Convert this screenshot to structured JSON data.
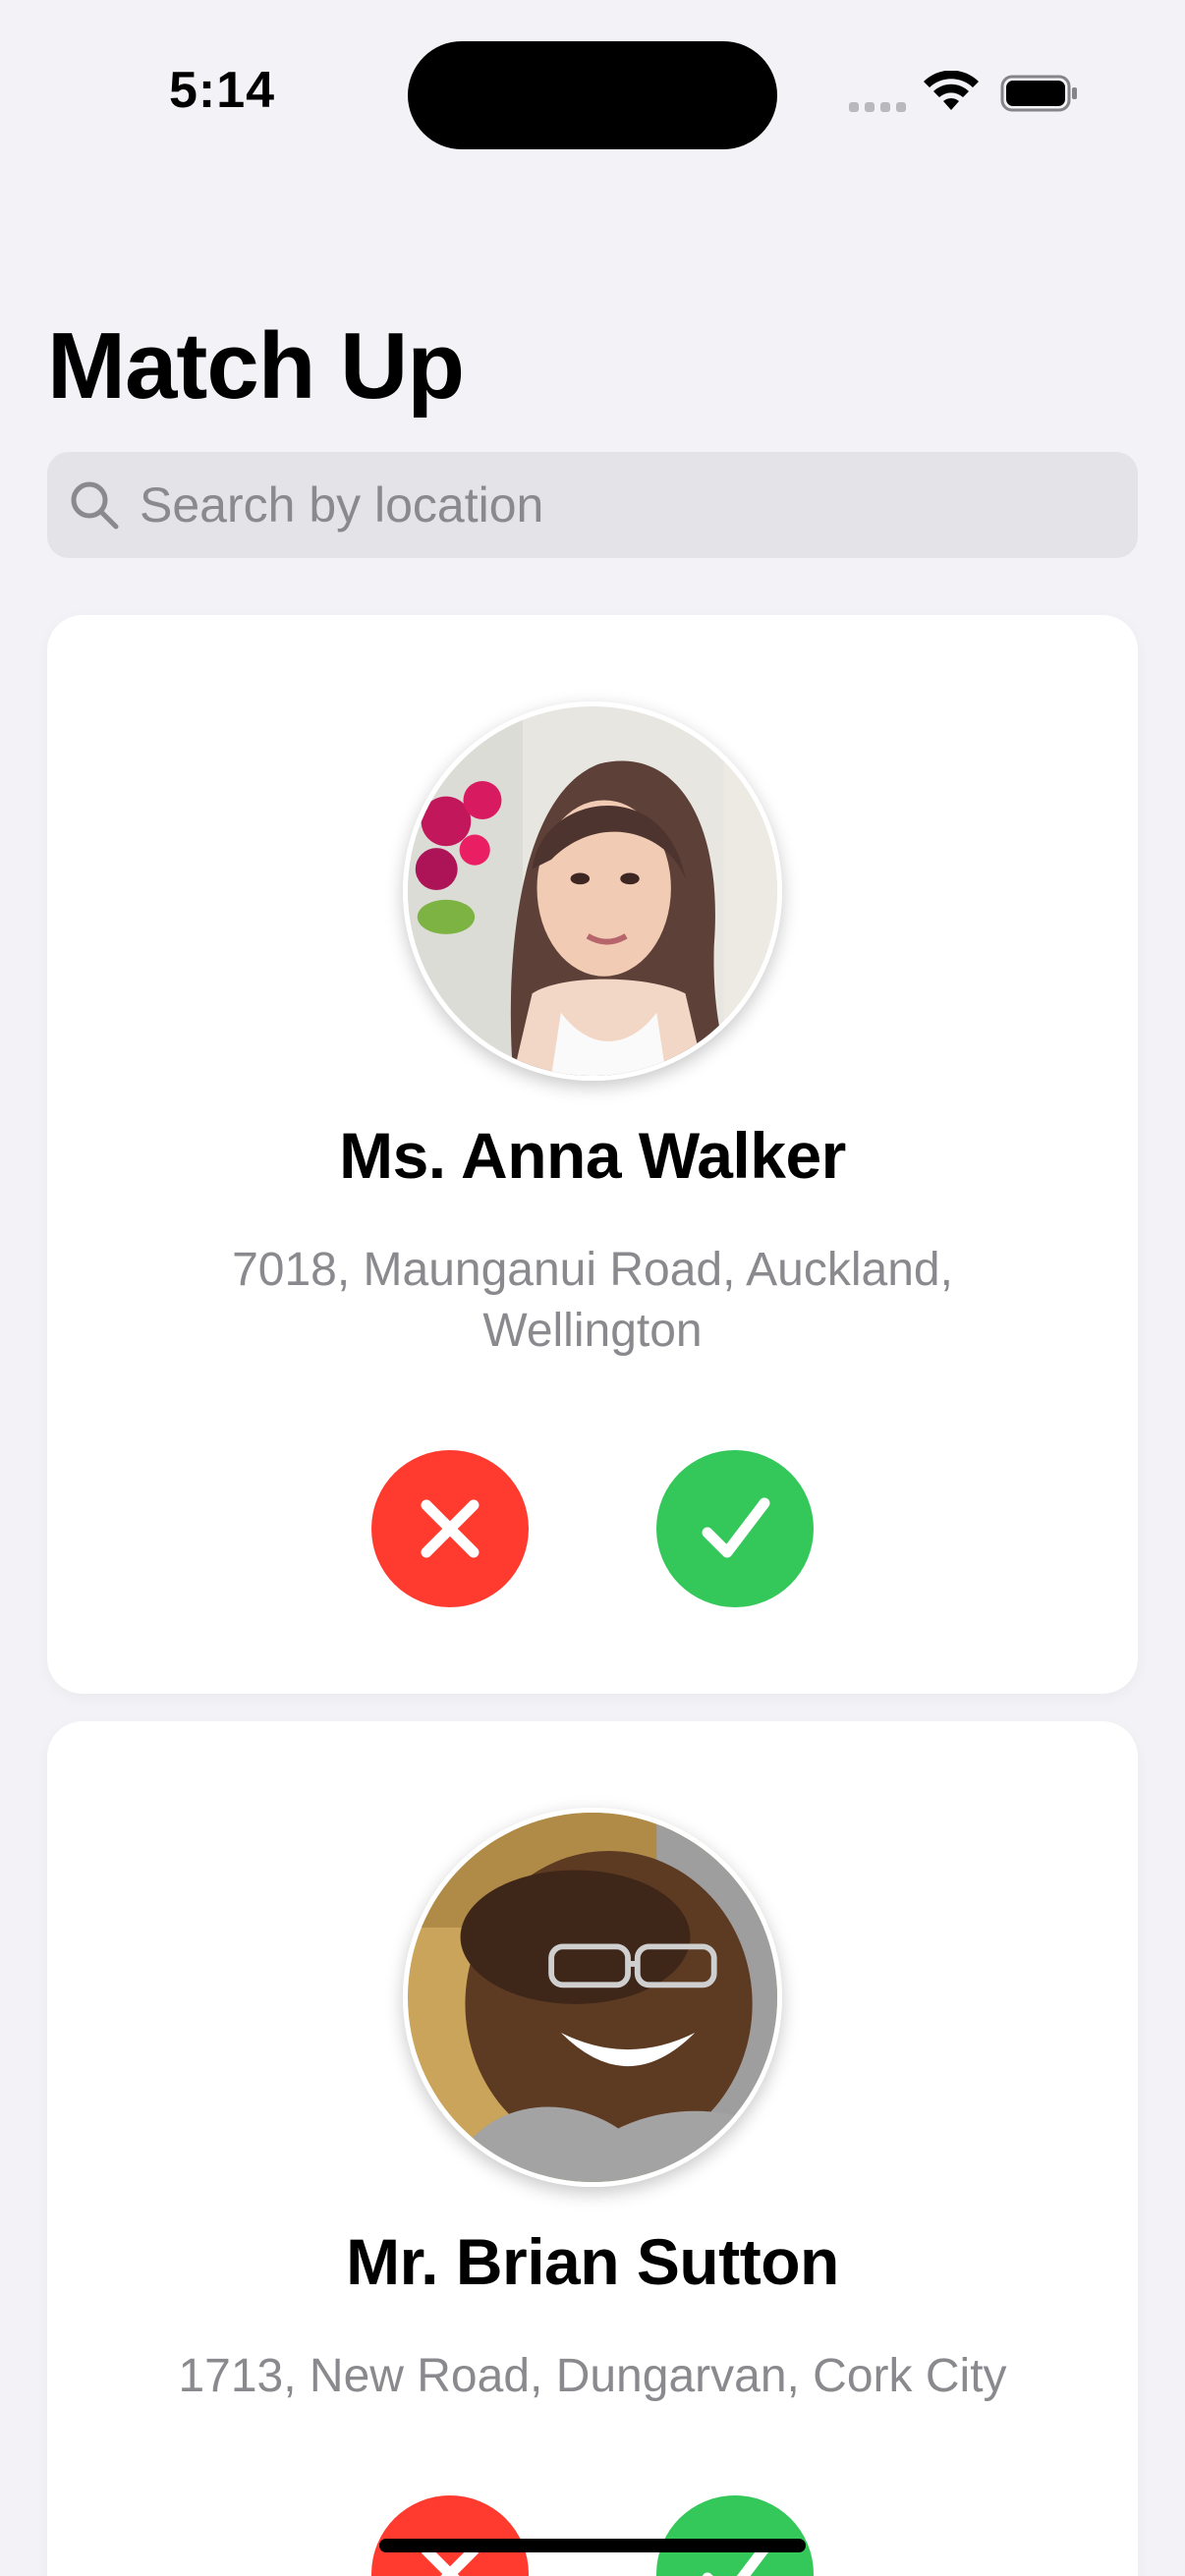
{
  "status_bar": {
    "time": "5:14"
  },
  "header": {
    "title": "Match Up"
  },
  "search": {
    "placeholder": "Search by location",
    "value": ""
  },
  "matches": [
    {
      "name": "Ms. Anna Walker",
      "address": "7018, Maunganui Road, Auckland, Wellington",
      "reject_icon": "x-mark-icon",
      "accept_icon": "checkmark-icon"
    },
    {
      "name": "Mr. Brian Sutton",
      "address": "1713, New Road, Dungarvan, Cork City",
      "reject_icon": "x-mark-icon",
      "accept_icon": "checkmark-icon"
    }
  ],
  "colors": {
    "background": "#f2f2f7",
    "card": "#ffffff",
    "reject": "#ff3b30",
    "accept": "#34c759",
    "secondary_text": "#8a8a8e",
    "search_fill": "#e3e3e8"
  }
}
